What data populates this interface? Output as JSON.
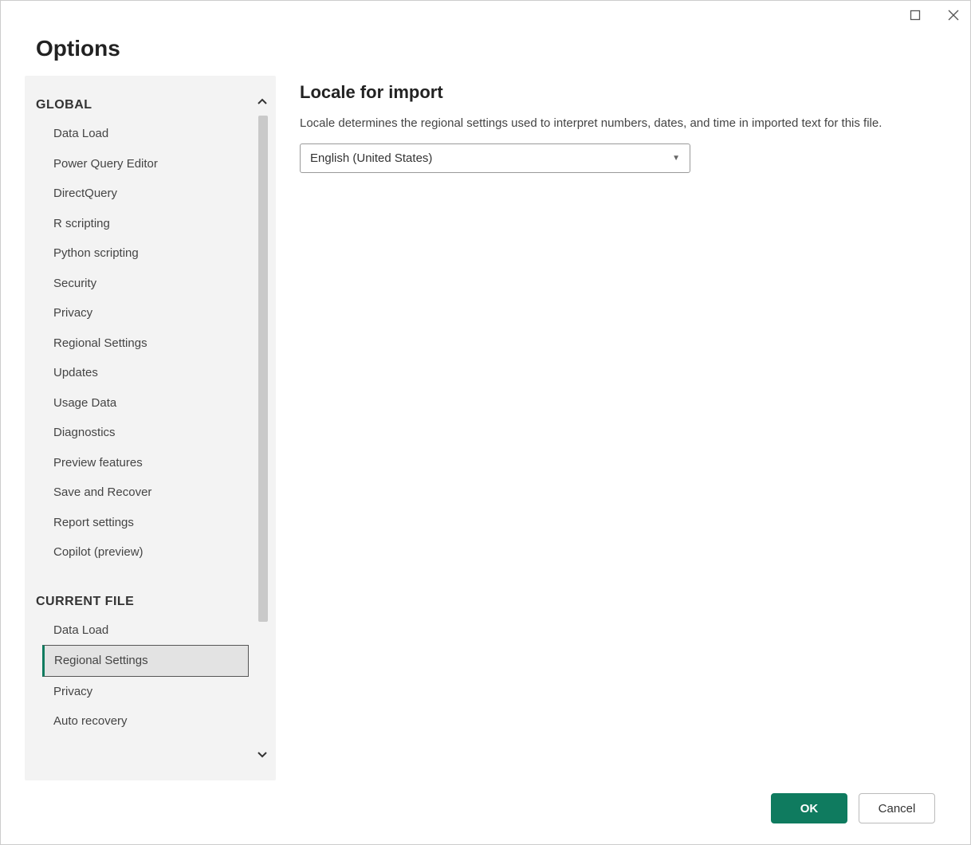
{
  "dialog": {
    "title": "Options"
  },
  "sidebar": {
    "sections": [
      {
        "header": "GLOBAL",
        "items": [
          "Data Load",
          "Power Query Editor",
          "DirectQuery",
          "R scripting",
          "Python scripting",
          "Security",
          "Privacy",
          "Regional Settings",
          "Updates",
          "Usage Data",
          "Diagnostics",
          "Preview features",
          "Save and Recover",
          "Report settings",
          "Copilot (preview)"
        ]
      },
      {
        "header": "CURRENT FILE",
        "items": [
          "Data Load",
          "Regional Settings",
          "Privacy",
          "Auto recovery"
        ]
      }
    ]
  },
  "content": {
    "heading": "Locale for import",
    "description": "Locale determines the regional settings used to interpret numbers, dates, and time in imported text for this file.",
    "locale_selected": "English (United States)"
  },
  "footer": {
    "ok_label": "OK",
    "cancel_label": "Cancel"
  }
}
